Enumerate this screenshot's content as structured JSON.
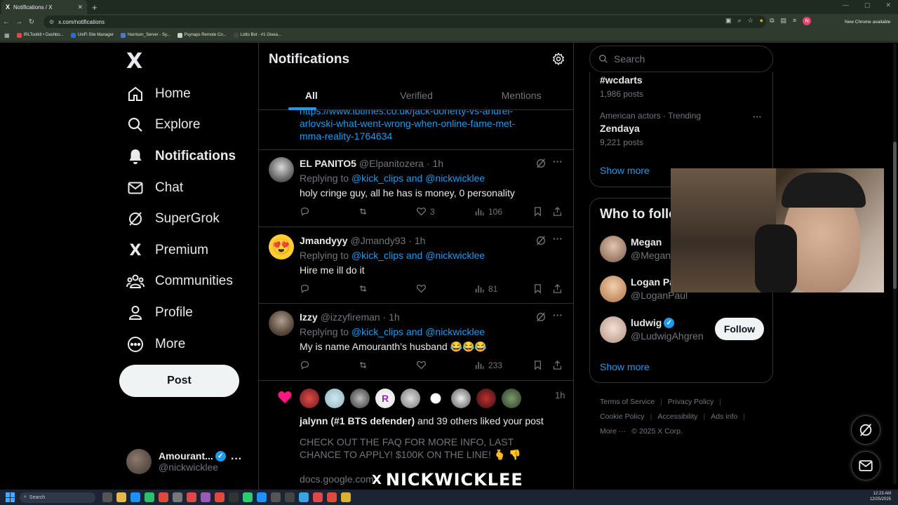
{
  "browser": {
    "tab_title": "Notifications / X",
    "tab_favicon": "X",
    "url": "x.com/notifications",
    "update_label": "New Chrome available",
    "profile_initial": "N",
    "bookmarks": [
      {
        "label": "IRLToolkit • Dashbo...",
        "color": "#e04848"
      },
      {
        "label": "UniFi Site Manager",
        "color": "#2a6bd8"
      },
      {
        "label": "Harrison_Server - Sy...",
        "color": "#4a7bd0"
      },
      {
        "label": "Psynaps Remote Co...",
        "color": "#cfcfcf"
      },
      {
        "label": "Lotto Bot - #1 Givea...",
        "color": "#444"
      }
    ]
  },
  "nav": {
    "logo": "X",
    "items": [
      {
        "label": "Home",
        "icon": "home-icon"
      },
      {
        "label": "Explore",
        "icon": "search-icon"
      },
      {
        "label": "Notifications",
        "icon": "bell-icon"
      },
      {
        "label": "Chat",
        "icon": "mail-icon"
      },
      {
        "label": "SuperGrok",
        "icon": "grok-icon"
      },
      {
        "label": "Premium",
        "icon": "x-icon"
      },
      {
        "label": "Communities",
        "icon": "communities-icon"
      },
      {
        "label": "Profile",
        "icon": "person-icon"
      },
      {
        "label": "More",
        "icon": "more-circle-icon"
      }
    ],
    "post_label": "Post",
    "account": {
      "name": "Amourant...",
      "handle": "@nickwicklee"
    }
  },
  "notifications": {
    "title": "Notifications",
    "tabs": [
      "All",
      "Verified",
      "Mentions"
    ],
    "link_text": "https://www.ibtimes.co.uk/jack-doherty-vs-andrei-arlovski-what-went-wrong-when-online-fame-met-mma-reality-1764634",
    "link_lines": [
      "https://www.ibtimes.co.uk/jack-doherty-vs-andrei-",
      "arlovski-what-went-wrong-when-online-fame-met-",
      "mma-reality-1764634"
    ],
    "replying_prefix": "Replying to ",
    "tweets": [
      {
        "name": "EL PANITO5",
        "handle": "@Elpanitozera",
        "time": "· 1h",
        "replying_to": "@kick_clips and @nickwicklee",
        "text": "holy cringe guy, all he has is money, 0 personality",
        "likes": "3",
        "views": "106"
      },
      {
        "name": "Jmandyyy",
        "handle": "@Jmandy93",
        "time": "· 1h",
        "replying_to": "@kick_clips and @nickwicklee",
        "text": "Hire me ill do it",
        "likes": "",
        "views": "81"
      },
      {
        "name": "Izzy",
        "handle": "@izzyfireman",
        "time": "· 1h",
        "replying_to": "@kick_clips and @nickwicklee",
        "text": "My is name Amouranth’s husband 😂😂😂",
        "likes": "",
        "views": "233"
      }
    ],
    "like_notification": {
      "time": "1h",
      "actor": "jalynn (#1 BTS defender)",
      "rest": " and 39 others liked your post",
      "snippet": "CHECK OUT THE FAQ FOR MORE INFO, LAST CHANCE TO APPLY!  $100K ON THE LINE! 🫰 👎",
      "link": "docs.google.com"
    }
  },
  "right": {
    "search_placeholder": "Search",
    "trends": [
      {
        "meta": "",
        "title": "#wcdarts",
        "count": "1,986 posts"
      },
      {
        "meta": "American actors · Trending",
        "title": "Zendaya",
        "count": "9,221 posts"
      }
    ],
    "show_more": "Show more",
    "who_title": "Who to follow",
    "people": [
      {
        "name": "Megan",
        "handle": "@Megan",
        "verified": false
      },
      {
        "name": "Logan Pa",
        "handle": "@LoganPaul",
        "verified": false
      },
      {
        "name": "ludwig",
        "handle": "@LudwigAhgren",
        "verified": true
      }
    ],
    "follow_label": "Follow",
    "footer": [
      "Terms of Service",
      "Privacy Policy",
      "Cookie Policy",
      "Accessibility",
      "Ads info",
      "More ···",
      "© 2025 X Corp."
    ]
  },
  "overlay": {
    "watermark_text": "NICKWICKLEE"
  },
  "taskbar": {
    "search_label": "Search",
    "time": "12:23 AM",
    "date": "12/25/2025"
  },
  "colors": {
    "accent": "#1d9bf0",
    "like": "#f91880",
    "bg": "#000000"
  }
}
